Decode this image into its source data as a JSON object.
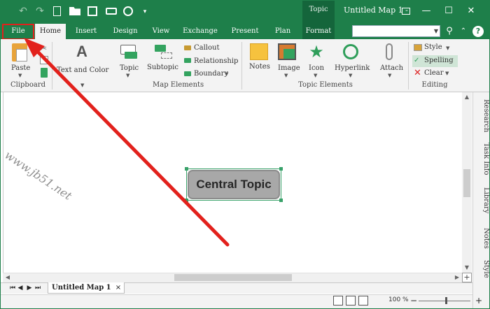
{
  "titlebar": {
    "context_tab": "Topic",
    "window_title": "Untitled Map 1 -"
  },
  "tabs": [
    {
      "label": "File"
    },
    {
      "label": "Home"
    },
    {
      "label": "Insert"
    },
    {
      "label": "Design"
    },
    {
      "label": "View"
    },
    {
      "label": "Exchange"
    },
    {
      "label": "Present"
    },
    {
      "label": "Plan"
    },
    {
      "label": "Format"
    }
  ],
  "search": {
    "value": ""
  },
  "ribbon": {
    "clipboard": {
      "paste": "Paste",
      "group": "Clipboard"
    },
    "text_and_color": "Text and Color",
    "map_elements": {
      "topic": "Topic",
      "subtopic": "Subtopic",
      "callout": "Callout",
      "relationship": "Relationship",
      "boundary": "Boundary",
      "group": "Map Elements"
    },
    "topic_elements": {
      "notes": "Notes",
      "image": "Image",
      "icon": "Icon",
      "hyperlink": "Hyperlink",
      "attach": "Attach",
      "group": "Topic Elements"
    },
    "editing": {
      "style": "Style",
      "spelling": "Spelling",
      "clear": "Clear",
      "group": "Editing"
    }
  },
  "canvas": {
    "central_topic": "Central Topic",
    "watermark": "www.jb51.net"
  },
  "side_panel": [
    "Research",
    "Task Info",
    "Library",
    "Notes",
    "Style"
  ],
  "doc_tab": {
    "label": "Untitled Map 1",
    "close": "×"
  },
  "status": {
    "zoom": "100 %"
  },
  "colors": {
    "brand": "#1e7f4a",
    "arrow": "#e2211c",
    "topic_fill": "#a8a8a8"
  }
}
